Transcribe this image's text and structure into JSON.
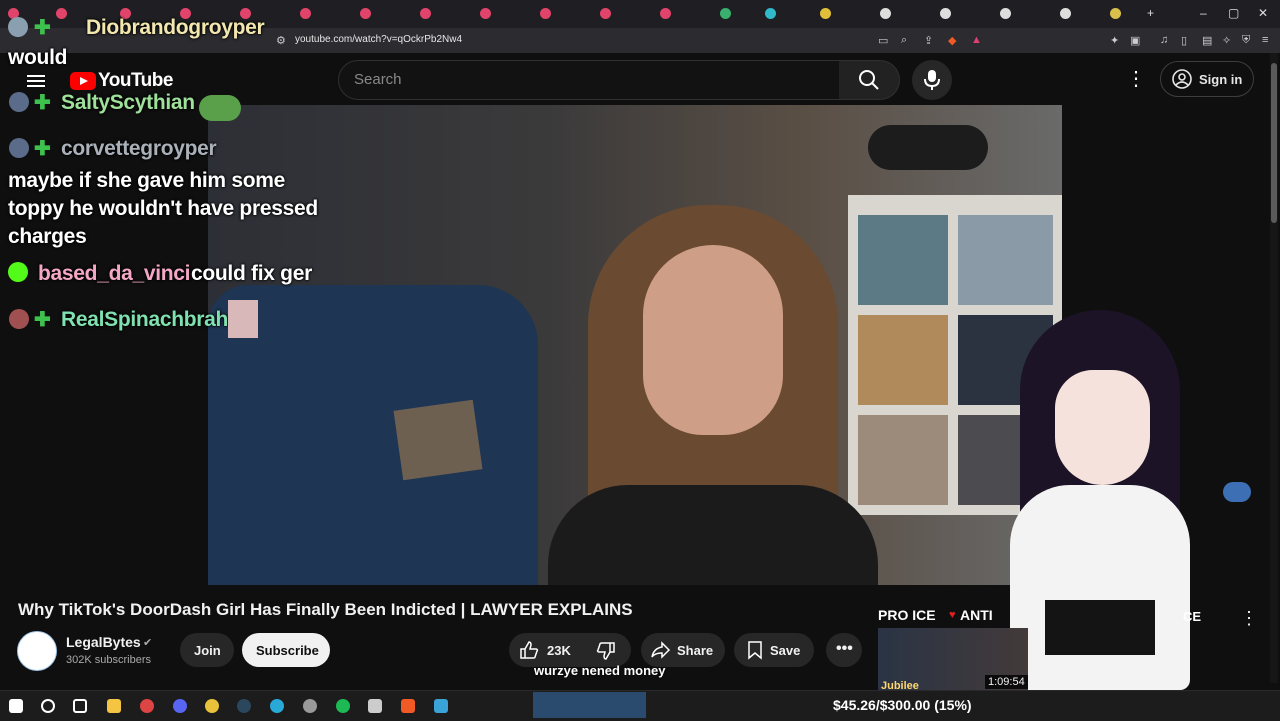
{
  "browser": {
    "url": "youtube.com/watch?v=qOckrPb2Nw4",
    "new_tab": "+",
    "window_controls": [
      "–",
      "▢",
      "✕"
    ]
  },
  "youtube": {
    "logo": "YouTube",
    "search_placeholder": "Search",
    "sign_in": "Sign in",
    "more": "⋮"
  },
  "chat": {
    "partial_line": "would",
    "top_user": "Diobrandogroyper",
    "messages": [
      {
        "user": "SaltyScythian",
        "text": "",
        "user_color": "#9fe09a"
      },
      {
        "user": "corvettegroyper",
        "text": "maybe if she gave him some toppy he wouldn't have pressed charges",
        "user_color": "#a9b0b8"
      },
      {
        "user": "based_da_vinci",
        "text": "could fix ger",
        "user_color": "#f5a8c6"
      },
      {
        "user": "RealSpinachbrah",
        "text": "",
        "user_color": "#7fe0b0"
      }
    ],
    "colors": {
      "plus": "#3ec24e",
      "text": "#ffffff"
    }
  },
  "video": {
    "title": "Why TikTok's DoorDash Girl Has Finally Been Indicted | LAWYER EXPLAINS",
    "channel": "LegalBytes",
    "subscribers": "302K subscribers",
    "join": "Join",
    "subscribe": "Subscribe",
    "likes": "23K",
    "share": "Share",
    "save": "Save",
    "caption": "wurzye nened money"
  },
  "side_video": {
    "headline": "PRO ICE",
    "headline2": "ANTI",
    "headline3": "CE",
    "channel_tag": "Jubilee",
    "duration": "1:09:54"
  },
  "taskbar": {
    "goal": "$45.26/$300.00 (15%)"
  }
}
